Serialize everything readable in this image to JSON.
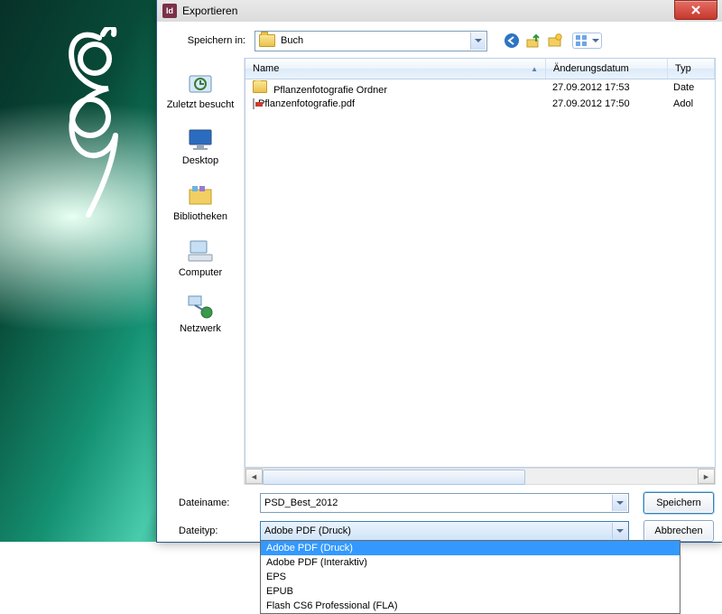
{
  "window": {
    "title": "Exportieren"
  },
  "toolbar": {
    "save_in_label": "Speichern in:",
    "location": "Buch"
  },
  "nav_icons": {
    "back": "back-icon",
    "up": "up-icon",
    "newfolder": "new-folder-icon",
    "views": "views-icon"
  },
  "places": [
    {
      "key": "recent",
      "label": "Zuletzt besucht"
    },
    {
      "key": "desktop",
      "label": "Desktop"
    },
    {
      "key": "libraries",
      "label": "Bibliotheken"
    },
    {
      "key": "computer",
      "label": "Computer"
    },
    {
      "key": "network",
      "label": "Netzwerk"
    }
  ],
  "columns": {
    "name": "Name",
    "modified": "Änderungsdatum",
    "type": "Typ"
  },
  "files": [
    {
      "icon": "folder",
      "name": "Pflanzenfotografie Ordner",
      "modified": "27.09.2012 17:53",
      "type": "Date"
    },
    {
      "icon": "pdf",
      "name": "Pflanzenfotografie.pdf",
      "modified": "27.09.2012 17:50",
      "type": "Adol"
    }
  ],
  "fields": {
    "filename_label": "Dateiname:",
    "filename_value": "PSD_Best_2012",
    "filetype_label": "Dateityp:",
    "filetype_value": "Adobe PDF (Druck)"
  },
  "filetype_options": [
    "Adobe PDF (Druck)",
    "Adobe PDF (Interaktiv)",
    "EPS",
    "EPUB",
    "Flash CS6 Professional (FLA)"
  ],
  "buttons": {
    "save": "Speichern",
    "cancel": "Abbrechen"
  }
}
